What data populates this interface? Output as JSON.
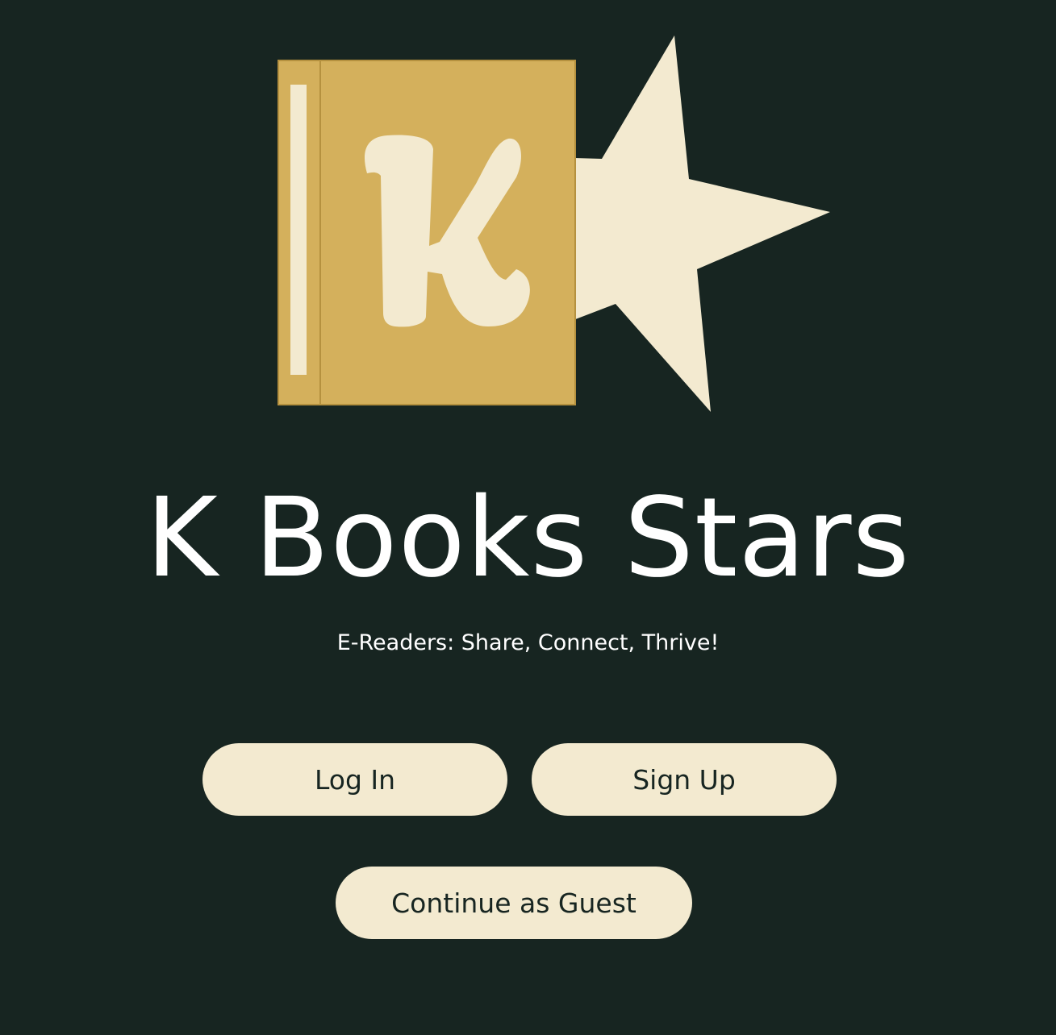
{
  "app": {
    "title": "K Books Stars",
    "tagline": "E-Readers: Share, Connect, Thrive!",
    "logo_letter": "K"
  },
  "actions": {
    "login_label": "Log In",
    "signup_label": "Sign Up",
    "guest_label": "Continue as Guest"
  },
  "colors": {
    "background": "#172521",
    "book": "#d4b05c",
    "cream": "#f3ead0",
    "text": "#ffffff"
  },
  "icons": {
    "logo": "book-with-star-icon"
  }
}
